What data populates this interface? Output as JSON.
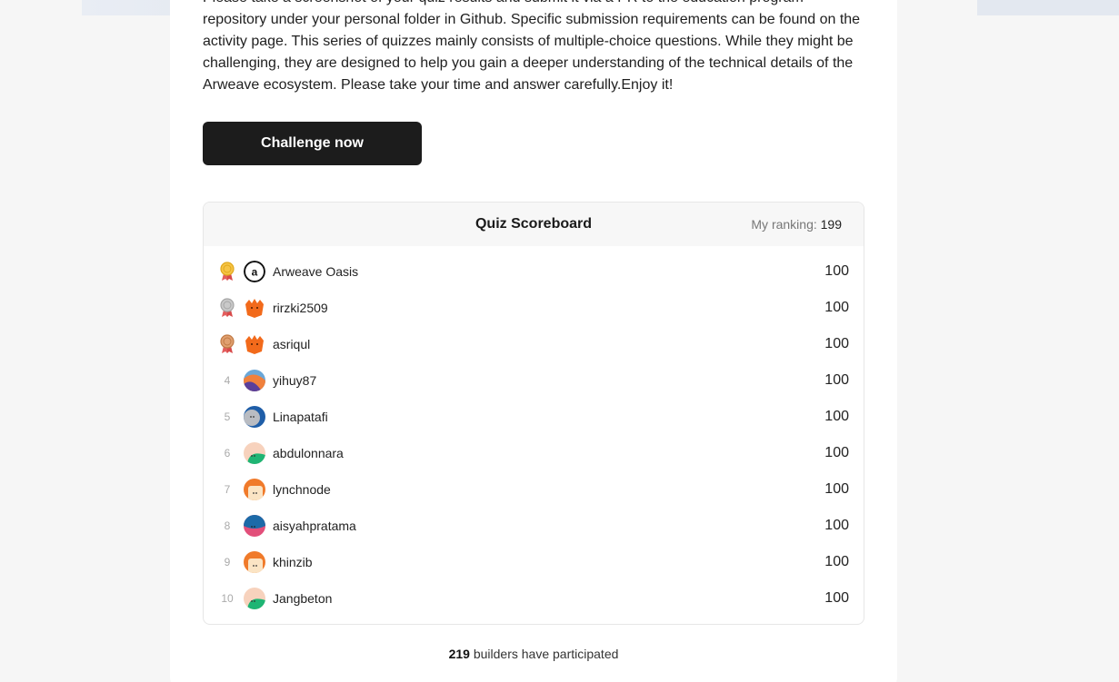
{
  "intro": {
    "text": "Please take a screenshot of your quiz results and submit it via a PR to the education program repository under your personal folder in Github. Specific submission requirements can be found on the activity page. This series of quizzes mainly consists of multiple-choice questions. While they might be challenging, they are designed to help you gain a deeper understanding of the technical details of the Arweave ecosystem. Please take your time and answer carefully.Enjoy it!"
  },
  "cta": {
    "label": "Challenge now"
  },
  "scoreboard": {
    "title": "Quiz Scoreboard",
    "my_ranking_label": "My ranking:",
    "my_ranking_value": "199",
    "rows": [
      {
        "rank": "",
        "medal": "gold-medal-icon",
        "avatar": "arweave-logo-avatar",
        "name": "Arweave Oasis",
        "score": "100"
      },
      {
        "rank": "",
        "medal": "silver-medal-icon",
        "avatar": "orange-fox-avatar",
        "name": "rirzki2509",
        "score": "100"
      },
      {
        "rank": "",
        "medal": "bronze-medal-icon",
        "avatar": "orange-fox-avatar",
        "name": "asriqul",
        "score": "100"
      },
      {
        "rank": "4",
        "medal": "",
        "avatar": "purple-orange-avatar",
        "name": "yihuy87",
        "score": "100"
      },
      {
        "rank": "5",
        "medal": "",
        "avatar": "blue-gray-avatar",
        "name": "Linapatafi",
        "score": "100"
      },
      {
        "rank": "6",
        "medal": "",
        "avatar": "green-peach-avatar",
        "name": "abdulonnara",
        "score": "100"
      },
      {
        "rank": "7",
        "medal": "",
        "avatar": "orange-cream-avatar",
        "name": "lynchnode",
        "score": "100"
      },
      {
        "rank": "8",
        "medal": "",
        "avatar": "blue-pink-avatar",
        "name": "aisyahpratama",
        "score": "100"
      },
      {
        "rank": "9",
        "medal": "",
        "avatar": "orange-cream-avatar",
        "name": "khinzib",
        "score": "100"
      },
      {
        "rank": "10",
        "medal": "",
        "avatar": "green-peach-avatar",
        "name": "Jangbeton",
        "score": "100"
      }
    ]
  },
  "footer": {
    "count": "219",
    "text": "builders have participated"
  }
}
